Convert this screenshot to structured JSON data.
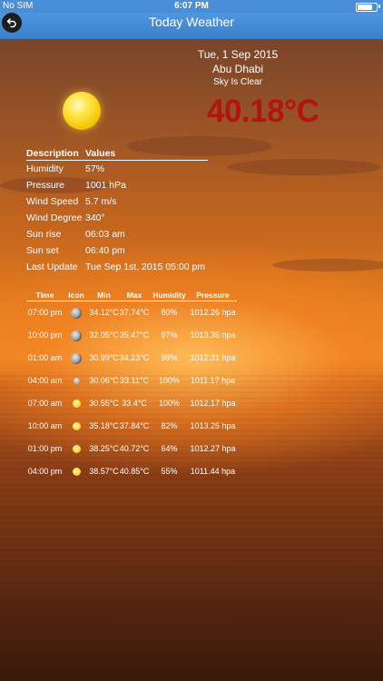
{
  "status_bar": {
    "carrier": "No SIM",
    "time": "6:07 PM"
  },
  "nav": {
    "title": "Today Weather"
  },
  "current": {
    "date": "Tue, 1 Sep 2015",
    "city": "Abu Dhabi",
    "condition": "Sky Is Clear",
    "temperature": "40.18°C"
  },
  "details": {
    "header_description": "Description",
    "header_values": "Values",
    "rows": [
      {
        "label": "Humidity",
        "value": "57%"
      },
      {
        "label": "Pressure",
        "value": "1001 hPa"
      },
      {
        "label": "Wind Speed",
        "value": "5.7 m/s"
      },
      {
        "label": "Wind Degree",
        "value": "340°"
      },
      {
        "label": "Sun rise",
        "value": "06:03 am"
      },
      {
        "label": "Sun set",
        "value": "06:40 pm"
      },
      {
        "label": "Last Update",
        "value": "Tue Sep 1st, 2015 05:00 pm"
      }
    ]
  },
  "forecast": {
    "headers": {
      "time": "Time",
      "icon": "Icon",
      "min": "Min",
      "max": "Max",
      "humidity": "Humidity",
      "pressure": "Pressure"
    },
    "rows": [
      {
        "time": "07:00 pm",
        "icon": "moon-icon",
        "min": "34.12°C",
        "max": "37.74°C",
        "humidity": "80%",
        "pressure": "1012.26 hpa"
      },
      {
        "time": "10:00 pm",
        "icon": "moon-icon",
        "min": "32.05°C",
        "max": "35.47°C",
        "humidity": "97%",
        "pressure": "1013.35 hpa"
      },
      {
        "time": "01:00 am",
        "icon": "moon-icon",
        "min": "30.99°C",
        "max": "34.23°C",
        "humidity": "98%",
        "pressure": "1012.31 hpa"
      },
      {
        "time": "04:00 am",
        "icon": "moon-small-icon",
        "min": "30.06°C",
        "max": "33.11°C",
        "humidity": "100%",
        "pressure": "1011.17 hpa"
      },
      {
        "time": "07:00 am",
        "icon": "sun-icon",
        "min": "30.55°C",
        "max": "33.4°C",
        "humidity": "100%",
        "pressure": "1012.17 hpa"
      },
      {
        "time": "10:00 am",
        "icon": "sun-icon",
        "min": "35.18°C",
        "max": "37.84°C",
        "humidity": "82%",
        "pressure": "1013.25 hpa"
      },
      {
        "time": "01:00 pm",
        "icon": "sun-icon",
        "min": "38.25°C",
        "max": "40.72°C",
        "humidity": "64%",
        "pressure": "1012.27 hpa"
      },
      {
        "time": "04:00 pm",
        "icon": "sun-icon",
        "min": "38.57°C",
        "max": "40.85°C",
        "humidity": "55%",
        "pressure": "1011.44 hpa"
      }
    ]
  },
  "colors": {
    "nav_blue": "#3b7fcb",
    "temperature_red": "#b3140f"
  }
}
